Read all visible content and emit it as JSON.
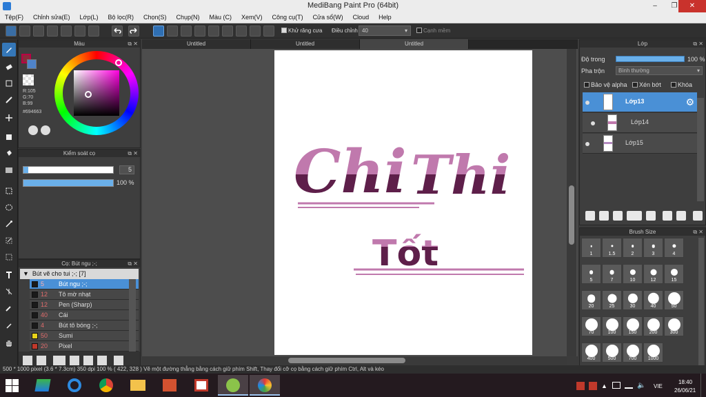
{
  "app": {
    "title": "MediBang Paint Pro (64bit)",
    "minimize": "–",
    "maximize": "❐",
    "close": "✕"
  },
  "menu": [
    "Tệp(F)",
    "Chỉnh sửa(E)",
    "Lớp(L)",
    "Bộ lọc(R)",
    "Chọn(S)",
    "Chụp(N)",
    "Màu (C)",
    "Xem(V)",
    "Công cụ(T)",
    "Cửa sổ(W)",
    "Cloud",
    "Help"
  ],
  "toolbar": {
    "antialias_label": "Khử răng cưa",
    "adjust_label": "Điều chỉnh",
    "adjust_value": "40",
    "smooth_label": "Cạnh mềm"
  },
  "color_panel": {
    "title": "Màu",
    "r": "R:105",
    "g": "G:70",
    "b": "B:99",
    "hex": "#694663",
    "main_color": "#8b2a3a",
    "sub_color": "#4f83c9"
  },
  "brush_control": {
    "title": "Kiểm soát cọ",
    "size_value": "5",
    "size_fraction": 0.05,
    "opacity_value": "100 %",
    "opacity_fraction": 1.0
  },
  "brush_panel": {
    "title": "Cọ: Bút ngu ;-;",
    "group": "Bút vẽ cho tui ;-; [7]",
    "items": [
      {
        "size": "5",
        "name": "Bút ngu ;-;",
        "swatch": "#1a1a1a",
        "selected": true
      },
      {
        "size": "12",
        "name": "Tô mờ nhạt",
        "swatch": "#1a1a1a",
        "selected": false
      },
      {
        "size": "12",
        "name": "Pen (Sharp)",
        "swatch": "#1a1a1a",
        "selected": false
      },
      {
        "size": "40",
        "name": "Cái",
        "swatch": "#1a1a1a",
        "selected": false
      },
      {
        "size": "4",
        "name": "Bút tô bóng ;-;",
        "swatch": "#1a1a1a",
        "selected": false
      },
      {
        "size": "50",
        "name": "Sumi",
        "swatch": "#e8d21a",
        "selected": false
      },
      {
        "size": "20",
        "name": "Pixel",
        "swatch": "#c0392b",
        "selected": false
      }
    ]
  },
  "canvas": {
    "tabs": [
      "Untitled",
      "Untitled",
      "Untitled"
    ],
    "active_tab": 2,
    "text_line1_a": "Chi",
    "text_line1_b": "Thi",
    "text_line2": "Tốt",
    "ink_light": "#c079ad",
    "ink_dark": "#5e1f4a"
  },
  "layer_panel": {
    "title": "Lớp",
    "opacity_label": "Độ trong",
    "opacity_value": "100 %",
    "opacity_fraction": 1.0,
    "blend_label": "Pha trộn",
    "blend_value": "Bình thường",
    "protect_alpha": "Bảo vệ alpha",
    "clipping": "Xén bớt",
    "lock": "Khóa",
    "layers": [
      {
        "name": "Lớp13",
        "selected": true
      },
      {
        "name": "Lớp14",
        "selected": false
      },
      {
        "name": "Lớp15",
        "selected": false
      }
    ]
  },
  "size_panel": {
    "title": "Brush Size",
    "sizes": [
      "1",
      "1.5",
      "2",
      "3",
      "4",
      "5",
      "7",
      "10",
      "12",
      "15",
      "20",
      "25",
      "30",
      "40",
      "50",
      "70",
      "100",
      "150",
      "200",
      "300",
      "400",
      "500",
      "700",
      "1000"
    ]
  },
  "status": {
    "text": "500 * 1000 pixel  (3.6 * 7.3cm)  350 dpi  100 %  ( 422, 328 )  Vẽ một đường thẳng bằng cách giữ phím Shift, Thay đổi cỡ cọ bằng cách giữ phím Ctrl, Alt và kéo"
  },
  "taskbar": {
    "lang": "VIE",
    "time": "18:40",
    "date": "26/06/21"
  }
}
